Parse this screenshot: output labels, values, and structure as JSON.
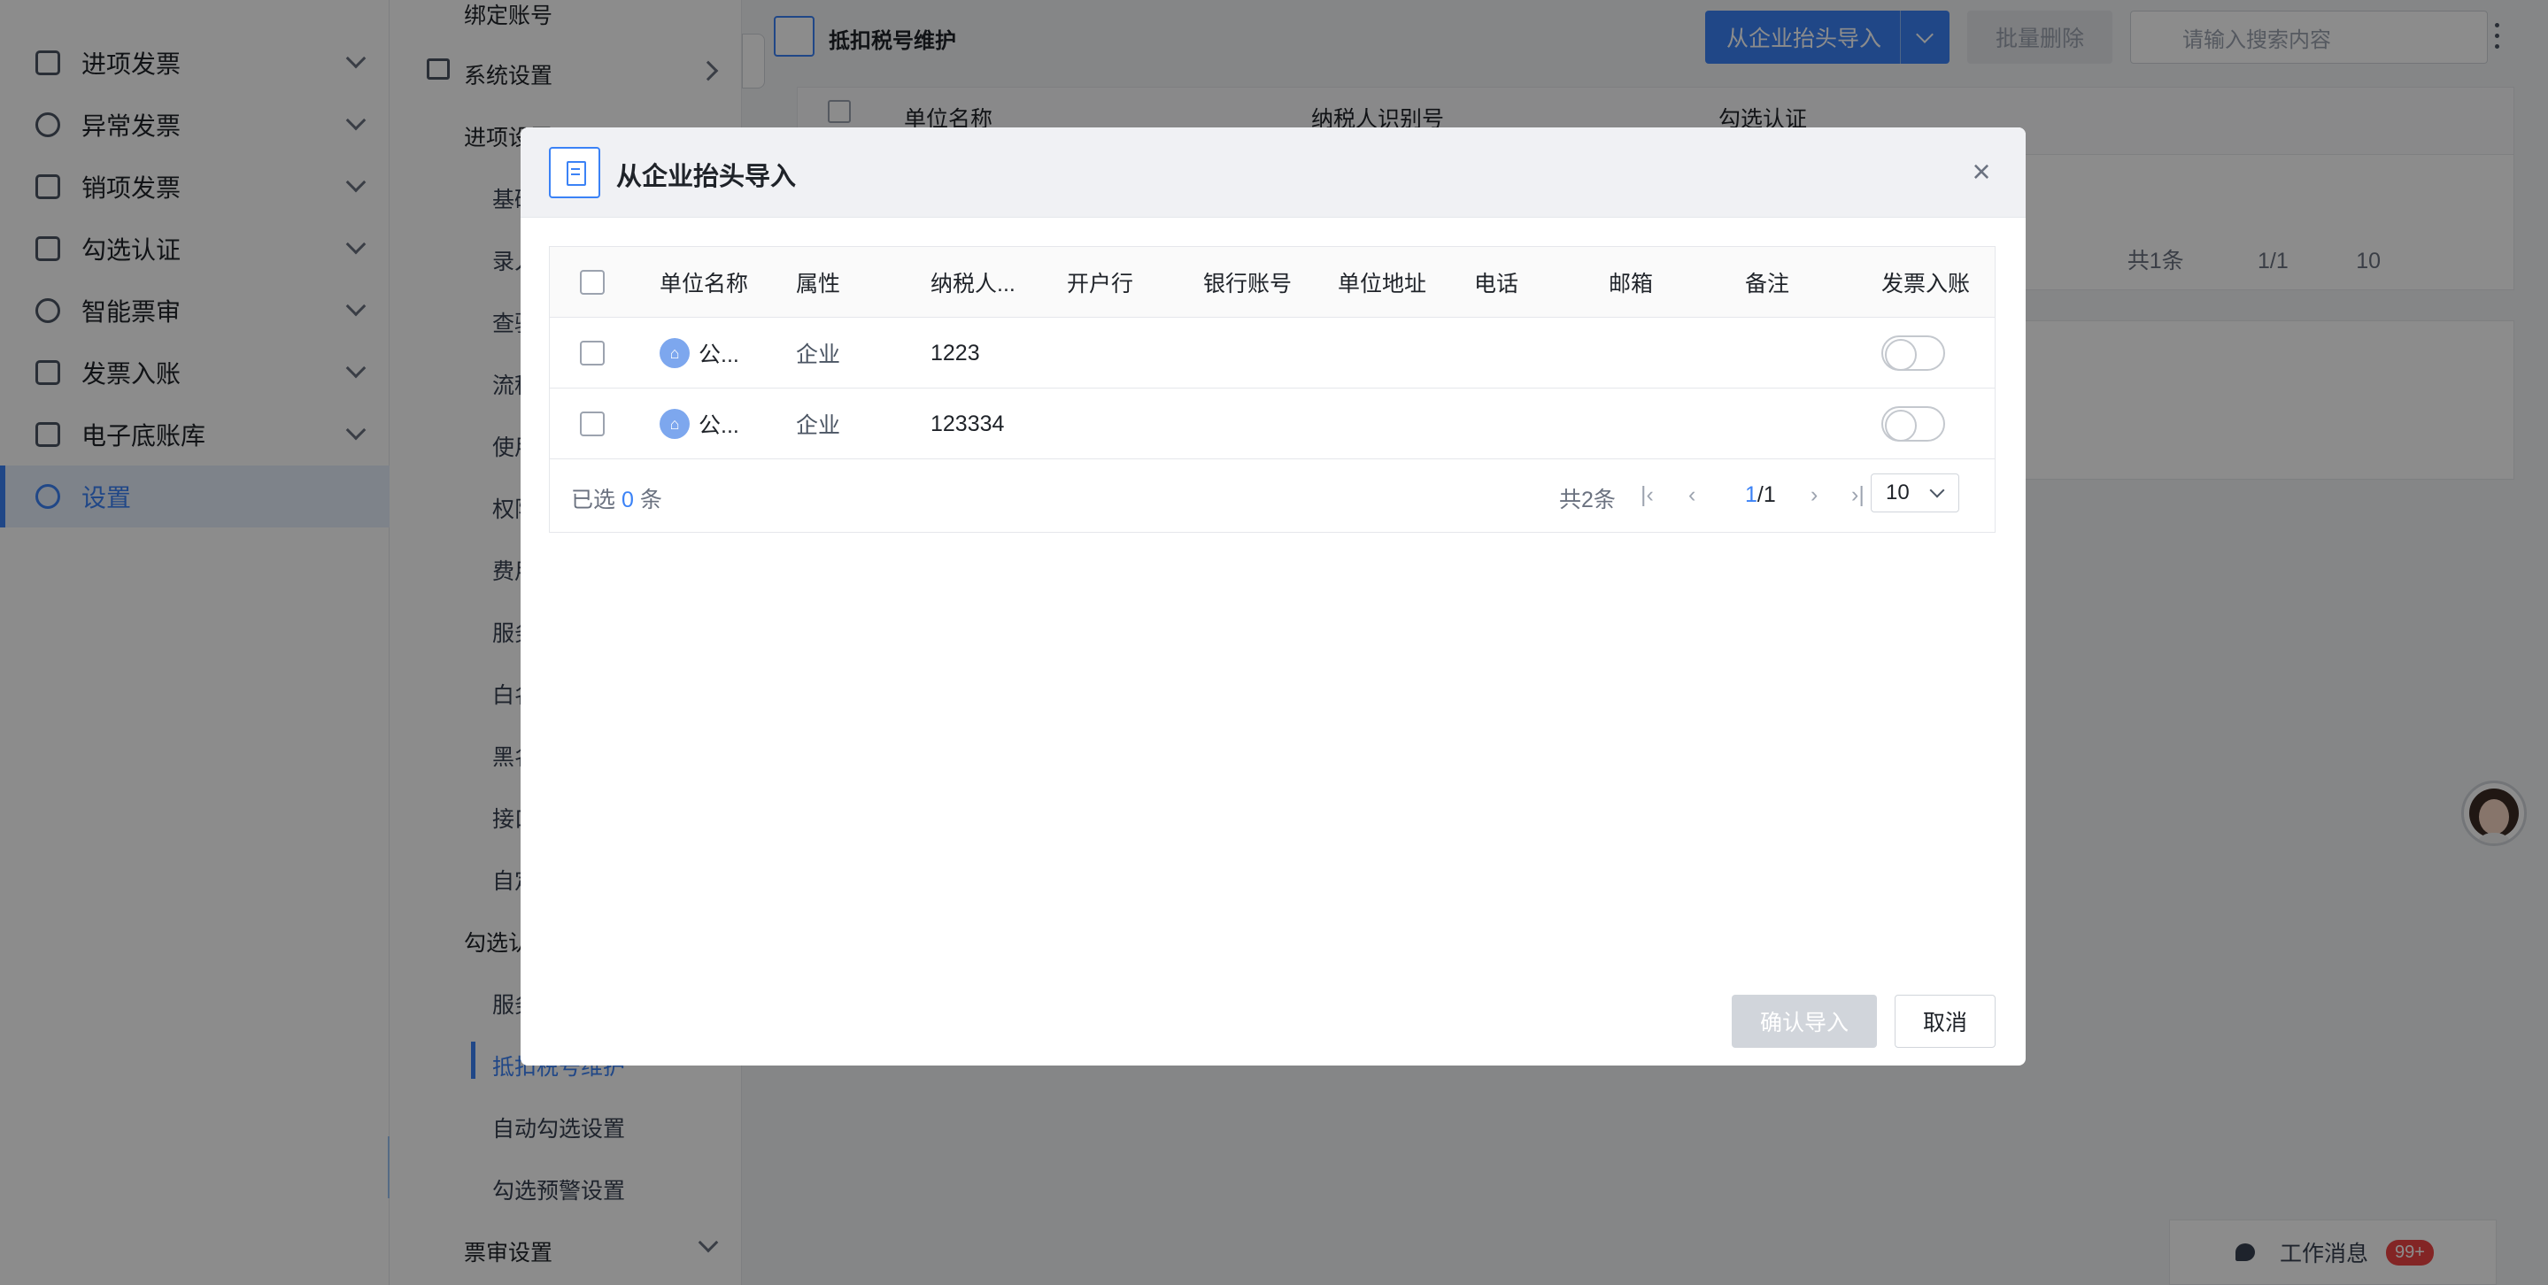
{
  "sidebar": {
    "items": [
      {
        "label": "进项发票",
        "icon": "invoice-in-icon"
      },
      {
        "label": "异常发票",
        "icon": "at-sign-icon"
      },
      {
        "label": "销项发票",
        "icon": "invoice-out-icon"
      },
      {
        "label": "勾选认证",
        "icon": "check-certify-icon"
      },
      {
        "label": "智能票审",
        "icon": "smart-review-icon"
      },
      {
        "label": "发票入账",
        "icon": "invoice-posting-icon"
      },
      {
        "label": "电子底账库",
        "icon": "ledger-icon"
      },
      {
        "label": "设置",
        "icon": "settings-icon",
        "active": true
      }
    ]
  },
  "subnav": {
    "bind_account": "绑定账号",
    "system_settings": "系统设置",
    "input_settings": "进项设置",
    "input_children": [
      "基础",
      "录入",
      "查验",
      "流程",
      "使用",
      "权限",
      "费用",
      "服务",
      "白名",
      "黑名",
      "接口",
      "自定"
    ],
    "check_cert_group": "勾选认",
    "check_children": [
      "服务",
      "抵扣税号维护"
    ],
    "auto_check": "自动勾选设置",
    "check_warning": "勾选预警设置",
    "review_settings": "票审设置"
  },
  "main": {
    "page_title": "抵扣税号维护",
    "import_button": "从企业抬头导入",
    "batch_delete_button": "批量删除",
    "search_placeholder": "请输入搜索内容",
    "columns": [
      "单位名称",
      "纳税人识别号",
      "勾选认证"
    ],
    "total": "共1条",
    "page": "1/1",
    "page_size": "10"
  },
  "dialog": {
    "title": "从企业抬头导入",
    "columns": [
      "单位名称",
      "属性",
      "纳税人...",
      "开户行",
      "银行账号",
      "单位地址",
      "电话",
      "邮箱",
      "备注",
      "发票入账"
    ],
    "rows": [
      {
        "name": "公...",
        "attr": "企业",
        "taxno": "1223",
        "bank": "",
        "account": "",
        "address": "",
        "phone": "",
        "email": "",
        "remark": "",
        "posting": false
      },
      {
        "name": "公...",
        "attr": "企业",
        "taxno": "123334",
        "bank": "",
        "account": "",
        "address": "",
        "phone": "",
        "email": "",
        "remark": "",
        "posting": false
      }
    ],
    "selected_prefix": "已选",
    "selected_count": "0",
    "selected_suffix": "条",
    "total": "共2条",
    "page_current": "1",
    "page_total": "/1",
    "page_size": "10",
    "confirm_button": "确认导入",
    "cancel_button": "取消"
  },
  "chat": {
    "label": "工作消息",
    "badge": "99+"
  },
  "colors": {
    "accent": "#3b82f6",
    "overlay": "rgba(0,0,0,0.45)",
    "badge": "#ef4444"
  }
}
